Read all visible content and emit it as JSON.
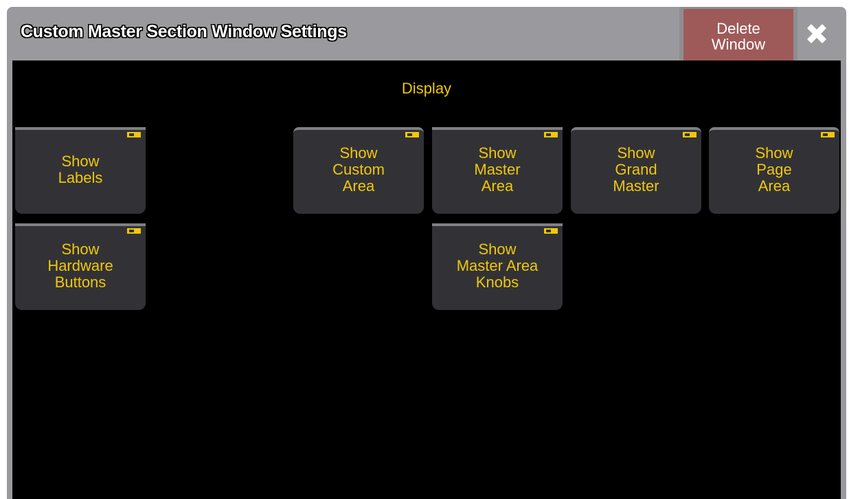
{
  "window": {
    "title": "Custom Master Section Window Settings",
    "delete_label_line1": "Delete",
    "delete_label_line2": "Window",
    "close_icon": "close-x-icon"
  },
  "display": {
    "section_title": "Display",
    "toggles": [
      {
        "lines": [
          "Show",
          "Labels"
        ],
        "state": "off"
      },
      {
        "lines": [
          "Show",
          "Custom",
          "Area"
        ],
        "state": "off"
      },
      {
        "lines": [
          "Show",
          "Master",
          "Area"
        ],
        "state": "off"
      },
      {
        "lines": [
          "Show",
          "Grand",
          "Master"
        ],
        "state": "off"
      },
      {
        "lines": [
          "Show",
          "Page",
          "Area"
        ],
        "state": "off"
      },
      {
        "lines": [
          "Show",
          "Hardware",
          "Buttons"
        ],
        "state": "off"
      },
      {
        "lines": [
          "Show",
          "Master Area",
          "Knobs"
        ],
        "state": "off"
      }
    ]
  },
  "colors": {
    "accent_yellow": "#f0c808",
    "titlebar_gray": "#9a9a9e",
    "delete_red": "#9e5a59",
    "tile_bg": "#323236",
    "content_bg": "#000000"
  }
}
